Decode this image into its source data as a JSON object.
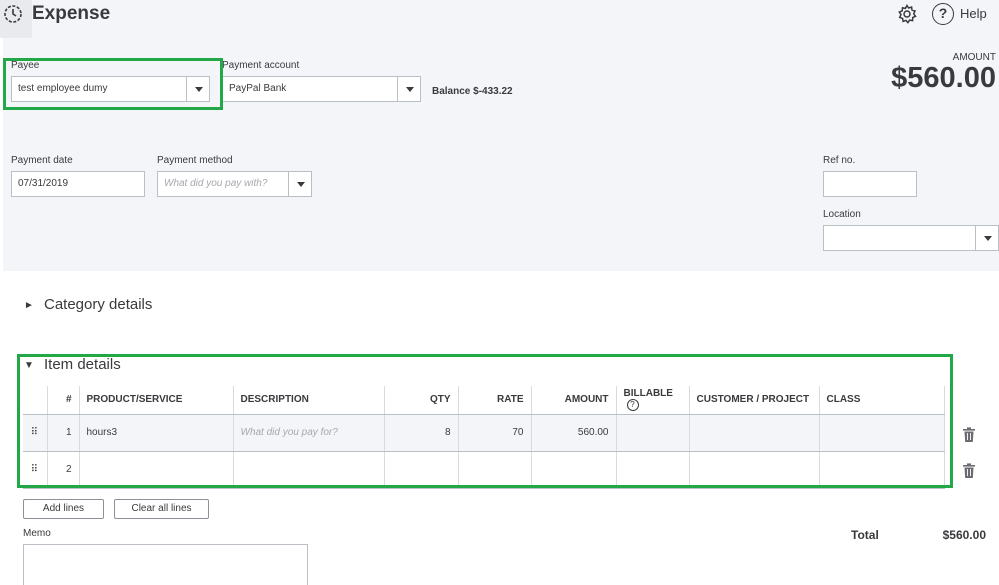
{
  "header": {
    "title": "Expense",
    "help_label": "Help",
    "help_glyph": "?",
    "amount_label": "AMOUNT",
    "amount_value": "$560.00"
  },
  "form": {
    "payee": {
      "label": "Payee",
      "value": "test employee dumy"
    },
    "payment_account": {
      "label": "Payment account",
      "value": "PayPal Bank"
    },
    "balance": "Balance $-433.22",
    "payment_date": {
      "label": "Payment date",
      "value": "07/31/2019"
    },
    "payment_method": {
      "label": "Payment method",
      "placeholder": "What did you pay with?"
    },
    "ref_no": {
      "label": "Ref no.",
      "value": ""
    },
    "location": {
      "label": "Location",
      "value": ""
    }
  },
  "sections": {
    "category_details": "Category details",
    "item_details": "Item details",
    "category_toggle_glyph": "►",
    "item_toggle_glyph": "▼"
  },
  "items_table": {
    "columns": [
      "",
      "#",
      "PRODUCT/SERVICE",
      "DESCRIPTION",
      "QTY",
      "RATE",
      "AMOUNT",
      "BILLABLE",
      "CUSTOMER / PROJECT",
      "CLASS"
    ],
    "billable_help_glyph": "?",
    "drag_glyph": "⠿",
    "rows": [
      {
        "num": "1",
        "product": "hours3",
        "description": "",
        "description_placeholder": "What did you pay for?",
        "qty": "8",
        "rate": "70",
        "amount": "560.00",
        "billable": "",
        "customer": "",
        "class": ""
      },
      {
        "num": "2",
        "product": "",
        "description": "",
        "description_placeholder": "",
        "qty": "",
        "rate": "",
        "amount": "",
        "billable": "",
        "customer": "",
        "class": ""
      }
    ]
  },
  "buttons": {
    "add_lines": "Add lines",
    "clear_all_lines": "Clear all lines"
  },
  "footer": {
    "memo_label": "Memo",
    "total_label": "Total",
    "total_value": "$560.00"
  },
  "colors": {
    "highlight": "#22a847",
    "panel_bg": "#f4f5f8",
    "text": "#393a3d"
  }
}
